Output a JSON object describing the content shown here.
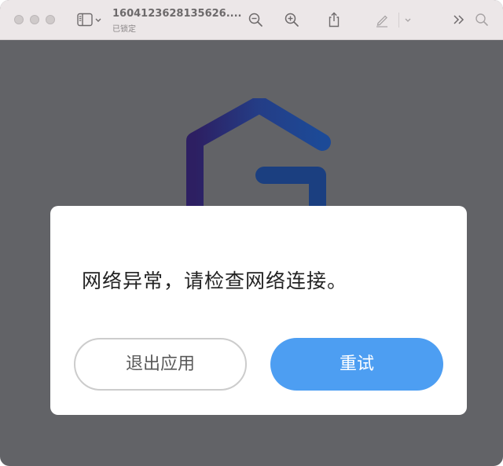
{
  "window": {
    "title": "1604123628135626....",
    "subtitle": "已锁定",
    "background_color": "#626367"
  },
  "toolbar": {
    "icons": [
      "sidebar-toggle-icon",
      "chevron-down-icon",
      "zoom-out-icon",
      "zoom-in-icon",
      "share-icon",
      "markup-pen-icon",
      "chevron-down-icon",
      "more-chevrons-icon",
      "search-icon"
    ]
  },
  "dialog": {
    "message": "网络异常，请检查网络连接。",
    "quit_label": "退出应用",
    "retry_label": "重试",
    "retry_color": "#4d9ef2"
  }
}
